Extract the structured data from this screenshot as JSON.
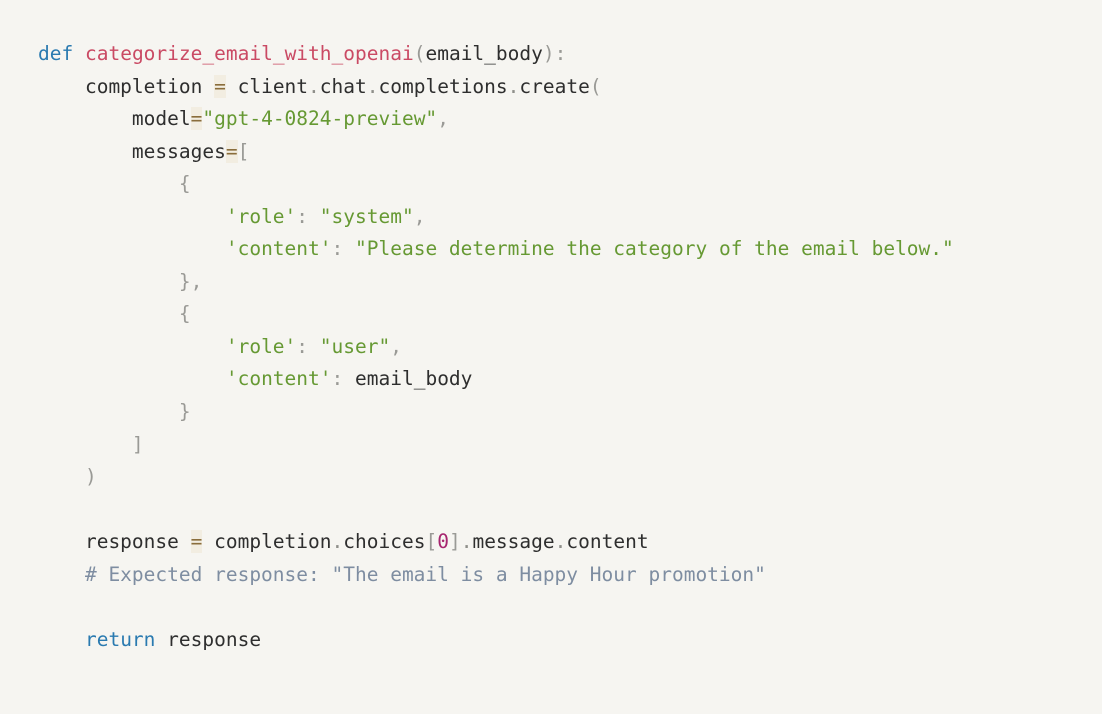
{
  "meta": {
    "language": "Python",
    "background_color": "#f6f5f1",
    "theme": "light-cream"
  },
  "colors": {
    "keyword": "#2a7ab0",
    "function_name": "#ca4a64",
    "plain_text": "#2e2e2e",
    "punctuation": "#9a9a96",
    "string": "#669933",
    "number": "#a6246e",
    "comment": "#7e8da1",
    "operator": "#8a6d3b",
    "operator_highlight": "#f2ede1"
  },
  "code": {
    "lines": [
      {
        "id": "line-def",
        "tokens": [
          {
            "t": "def",
            "c": "kw"
          },
          {
            "t": " ",
            "c": "plain"
          },
          {
            "t": "categorize_email_with_openai",
            "c": "fname"
          },
          {
            "t": "(",
            "c": "punct"
          },
          {
            "t": "email_body",
            "c": "plain"
          },
          {
            "t": ")",
            "c": "punct"
          },
          {
            "t": ":",
            "c": "punct"
          }
        ]
      },
      {
        "id": "line-completion",
        "tokens": [
          {
            "t": "    completion ",
            "c": "plain"
          },
          {
            "t": "=",
            "c": "op"
          },
          {
            "t": " client",
            "c": "plain"
          },
          {
            "t": ".",
            "c": "dot"
          },
          {
            "t": "chat",
            "c": "plain"
          },
          {
            "t": ".",
            "c": "dot"
          },
          {
            "t": "completions",
            "c": "plain"
          },
          {
            "t": ".",
            "c": "dot"
          },
          {
            "t": "create",
            "c": "plain"
          },
          {
            "t": "(",
            "c": "punct"
          }
        ]
      },
      {
        "id": "line-model",
        "tokens": [
          {
            "t": "        model",
            "c": "plain"
          },
          {
            "t": "=",
            "c": "op"
          },
          {
            "t": "\"gpt-4-0824-preview\"",
            "c": "str"
          },
          {
            "t": ",",
            "c": "punct"
          }
        ]
      },
      {
        "id": "line-messages",
        "tokens": [
          {
            "t": "        messages",
            "c": "plain"
          },
          {
            "t": "=",
            "c": "op"
          },
          {
            "t": "[",
            "c": "punct"
          }
        ]
      },
      {
        "id": "line-open-brace-1",
        "tokens": [
          {
            "t": "            {",
            "c": "punct"
          }
        ]
      },
      {
        "id": "line-role-system",
        "tokens": [
          {
            "t": "                ",
            "c": "plain"
          },
          {
            "t": "'role'",
            "c": "str"
          },
          {
            "t": ":",
            "c": "punct"
          },
          {
            "t": " ",
            "c": "plain"
          },
          {
            "t": "\"system\"",
            "c": "str"
          },
          {
            "t": ",",
            "c": "punct"
          }
        ]
      },
      {
        "id": "line-content-system",
        "tokens": [
          {
            "t": "                ",
            "c": "plain"
          },
          {
            "t": "'content'",
            "c": "str"
          },
          {
            "t": ":",
            "c": "punct"
          },
          {
            "t": " ",
            "c": "plain"
          },
          {
            "t": "\"Please determine the category of the email below.\"",
            "c": "str"
          }
        ]
      },
      {
        "id": "line-close-brace-comma",
        "tokens": [
          {
            "t": "            },",
            "c": "punct"
          }
        ]
      },
      {
        "id": "line-open-brace-2",
        "tokens": [
          {
            "t": "            {",
            "c": "punct"
          }
        ]
      },
      {
        "id": "line-role-user",
        "tokens": [
          {
            "t": "                ",
            "c": "plain"
          },
          {
            "t": "'role'",
            "c": "str"
          },
          {
            "t": ":",
            "c": "punct"
          },
          {
            "t": " ",
            "c": "plain"
          },
          {
            "t": "\"user\"",
            "c": "str"
          },
          {
            "t": ",",
            "c": "punct"
          }
        ]
      },
      {
        "id": "line-content-user",
        "tokens": [
          {
            "t": "                ",
            "c": "plain"
          },
          {
            "t": "'content'",
            "c": "str"
          },
          {
            "t": ":",
            "c": "punct"
          },
          {
            "t": " ",
            "c": "plain"
          },
          {
            "t": "email_body",
            "c": "plain"
          }
        ]
      },
      {
        "id": "line-close-brace-2",
        "tokens": [
          {
            "t": "            }",
            "c": "punct"
          }
        ]
      },
      {
        "id": "line-close-bracket",
        "tokens": [
          {
            "t": "        ]",
            "c": "punct"
          }
        ]
      },
      {
        "id": "line-close-paren",
        "tokens": [
          {
            "t": "    )",
            "c": "punct"
          }
        ]
      },
      {
        "id": "line-blank-1",
        "tokens": [
          {
            "t": " ",
            "c": "plain"
          }
        ]
      },
      {
        "id": "line-response",
        "tokens": [
          {
            "t": "    response ",
            "c": "plain"
          },
          {
            "t": "=",
            "c": "op"
          },
          {
            "t": " completion",
            "c": "plain"
          },
          {
            "t": ".",
            "c": "dot"
          },
          {
            "t": "choices",
            "c": "plain"
          },
          {
            "t": "[",
            "c": "punct"
          },
          {
            "t": "0",
            "c": "num"
          },
          {
            "t": "]",
            "c": "punct"
          },
          {
            "t": ".",
            "c": "dot"
          },
          {
            "t": "message",
            "c": "plain"
          },
          {
            "t": ".",
            "c": "dot"
          },
          {
            "t": "content",
            "c": "plain"
          }
        ]
      },
      {
        "id": "line-comment",
        "tokens": [
          {
            "t": "    # Expected response: \"The email is a Happy Hour promotion\"",
            "c": "cmt"
          }
        ]
      },
      {
        "id": "line-blank-2",
        "tokens": [
          {
            "t": " ",
            "c": "plain"
          }
        ]
      },
      {
        "id": "line-return",
        "tokens": [
          {
            "t": "    ",
            "c": "plain"
          },
          {
            "t": "return",
            "c": "kw"
          },
          {
            "t": " response",
            "c": "plain"
          }
        ]
      }
    ]
  }
}
